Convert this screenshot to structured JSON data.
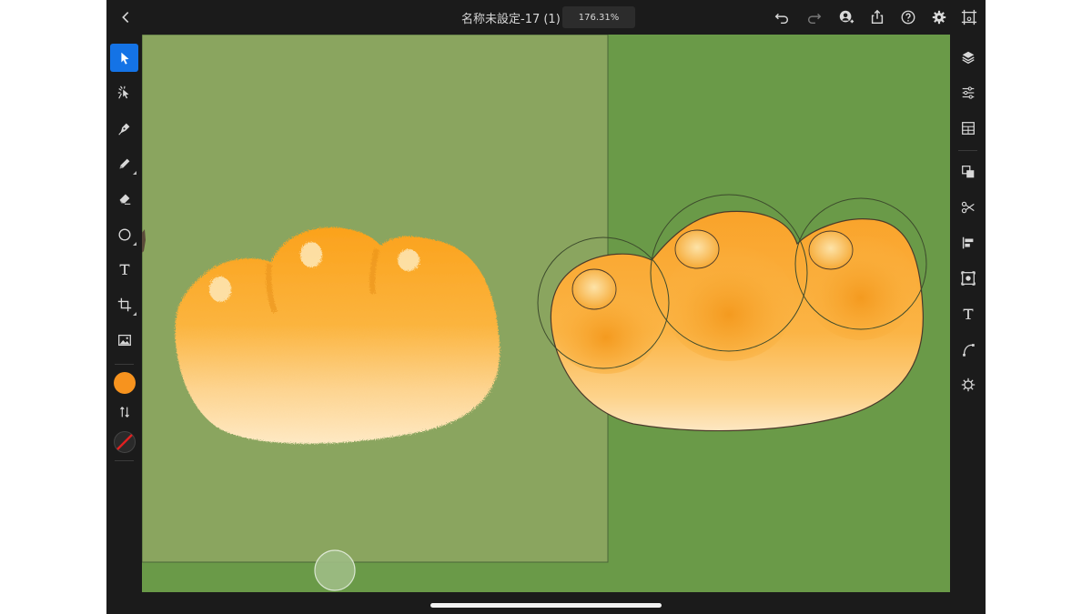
{
  "topbar": {
    "back_icon": "chevron-left-icon",
    "title": "名称未設定-17 (1)",
    "zoom": "176.31%",
    "actions": [
      "undo-icon",
      "redo-icon",
      "invite-user-icon",
      "share-icon",
      "help-icon",
      "settings-icon",
      "artboard-preview-icon"
    ]
  },
  "left_toolbar": {
    "tools": [
      "select-tool",
      "node-tool",
      "pen-tool",
      "pencil-tool",
      "eraser-tool",
      "shape-tool",
      "text-tool",
      "transform-tool",
      "image-tool"
    ],
    "active_tool": "select-tool",
    "fill_color": "#f7931e",
    "stroke_color": "#e02020",
    "swap_icon": "swap-colors-icon"
  },
  "right_toolbar": {
    "tools": [
      "layers-icon",
      "properties-icon",
      "libraries-icon",
      "combine-shapes-icon",
      "scissors-icon",
      "align-icon",
      "view-icon",
      "text-properties-icon",
      "path-icon",
      "plugins-icon"
    ]
  },
  "canvas": {
    "background": "#6a9a48",
    "overlay_image": "bun-photo-reference",
    "vector_art": "bun-vector-drawing",
    "colors": {
      "bun_orange": "#f5a623",
      "bun_light": "#fde3b0",
      "overlay": "#8aa55f"
    }
  }
}
